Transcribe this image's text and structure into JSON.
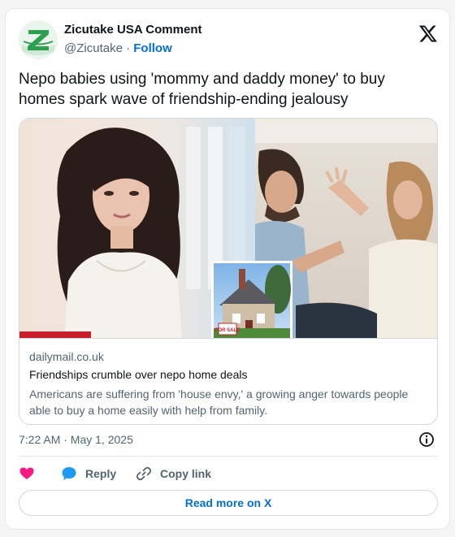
{
  "author": {
    "name": "Zicutake USA Comment",
    "handle": "@Zicutake",
    "separator": "·",
    "follow_label": "Follow",
    "avatar_letter": "Z"
  },
  "tweet": {
    "text": "Nepo babies using 'mommy and daddy money' to buy homes spark wave of friendship-ending jealousy",
    "timestamp": "7:22 AM · May 1, 2025"
  },
  "link_card": {
    "domain": "dailymail.co.uk",
    "title": "Friendships crumble over nepo home deals",
    "description": "Americans are suffering from 'house envy,' a growing anger towards people able to buy a home easily with help from family.",
    "sign_text": "FOR SALE"
  },
  "actions": {
    "reply_label": "Reply",
    "copy_label": "Copy link",
    "read_more_label": "Read more on X"
  },
  "icons": {
    "logo": "x-logo-icon",
    "info": "info-icon",
    "like": "heart-icon",
    "reply": "speech-bubble-icon",
    "copy": "link-icon"
  },
  "colors": {
    "accent": "#006fd6",
    "heart": "#f91880",
    "reply": "#1d9bf0",
    "avatar_green": "#2e9e4f",
    "text": "#0f1419",
    "muted": "#536471"
  }
}
